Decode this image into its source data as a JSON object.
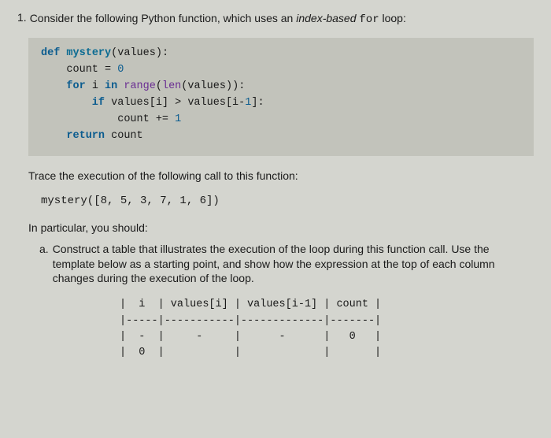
{
  "question": {
    "number": "1.",
    "text_before_italic": "Consider the following Python function, which uses an ",
    "italic_word": "index-based",
    "text_after_italic": " ",
    "mono_word": "for",
    "text_end": " loop:"
  },
  "code": {
    "l1_def": "def",
    "l1_fn": "mystery",
    "l1_rest": "(values):",
    "l2_a": "    count = ",
    "l2_num": "0",
    "l3_for": "    for",
    "l3_var": " i ",
    "l3_in": "in",
    "l3_sp": " ",
    "l3_range": "range",
    "l3_paren1": "(",
    "l3_len": "len",
    "l3_rest": "(values)):",
    "l4_if": "        if",
    "l4_rest": " values[i] > values[i-",
    "l4_num": "1",
    "l4_end": "]:",
    "l5_a": "            count += ",
    "l5_num": "1",
    "l6_ret": "    return",
    "l6_rest": " count"
  },
  "trace_prompt": "Trace the execution of the following call to this function:",
  "call": "mystery([8, 5, 3, 7, 1, 6])",
  "sub_header": "In particular, you should:",
  "part_a": {
    "letter": "a.",
    "text": "Construct a table that illustrates the execution of the loop during this function call. Use the template below as a starting point, and show how the expression at the top of each column changes during the execution of the loop."
  },
  "table": {
    "row1": "|  i  | values[i] | values[i-1] | count |",
    "row2": "|-----|-----------|-------------|-------|",
    "row3": "|  -  |     -     |      -      |   0   |",
    "row4": "|  0  |           |             |       |"
  }
}
